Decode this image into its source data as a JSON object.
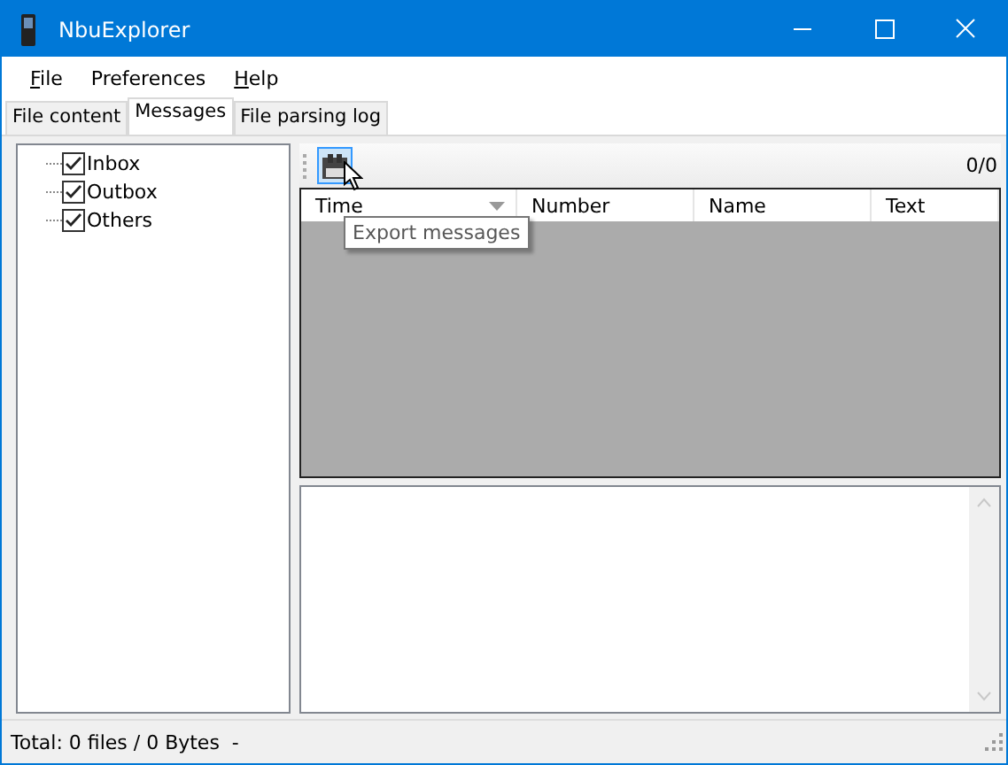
{
  "window": {
    "title": "NbuExplorer"
  },
  "menu": [
    {
      "label": "File",
      "underlined_key": true
    },
    {
      "label": "Preferences",
      "underlined_key": false
    },
    {
      "label": "Help",
      "underlined_key": true
    }
  ],
  "tabs": [
    {
      "label": "File content",
      "selected": false
    },
    {
      "label": "Messages",
      "selected": true
    },
    {
      "label": "File parsing log",
      "selected": false
    }
  ],
  "tree": [
    {
      "label": "Inbox",
      "checked": true
    },
    {
      "label": "Outbox",
      "checked": true
    },
    {
      "label": "Others",
      "checked": true
    }
  ],
  "toolbar": {
    "counter": "0/0",
    "tooltip": "Export messages"
  },
  "table": {
    "columns": [
      {
        "label": "Time",
        "sorted": true
      },
      {
        "label": "Number",
        "sorted": false
      },
      {
        "label": "Name",
        "sorted": false
      },
      {
        "label": "Text",
        "sorted": false
      }
    ]
  },
  "status_bar": "Total: 0 files / 0 Bytes  -"
}
